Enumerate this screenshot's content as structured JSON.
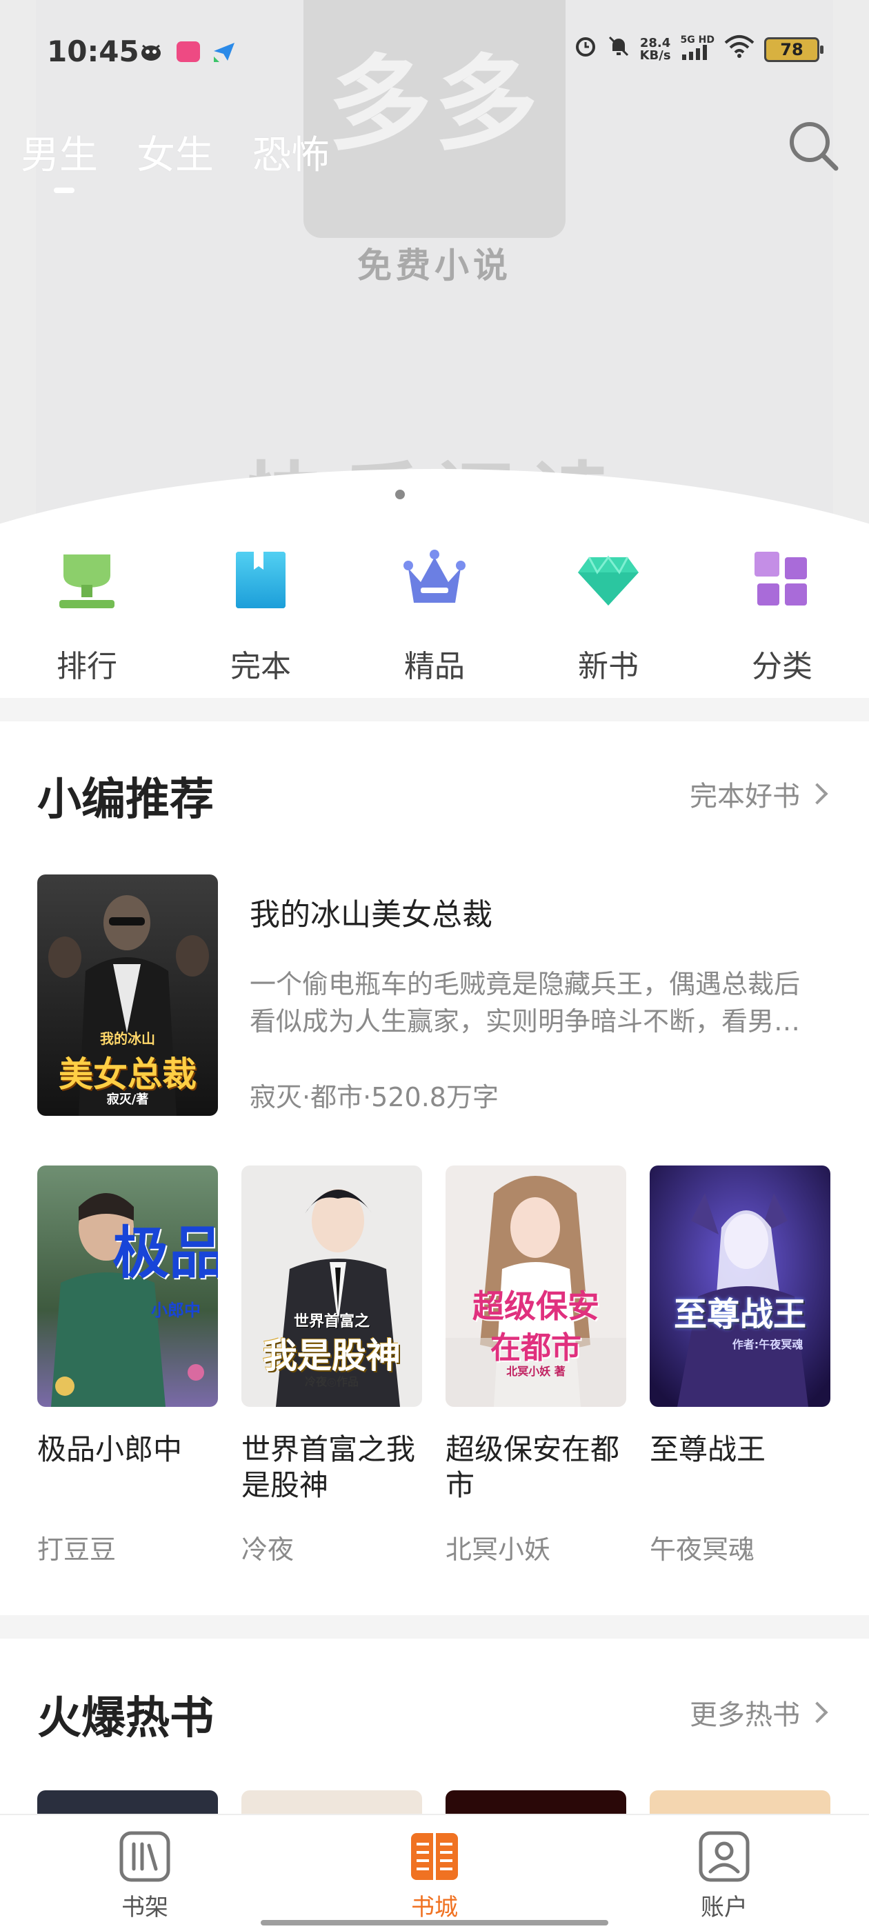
{
  "status_bar": {
    "time": "10:45",
    "net_speed_value": "28.4",
    "net_speed_unit": "KB/s",
    "net_type": "5G HD",
    "battery": "78"
  },
  "banner": {
    "logo_text": "多多",
    "logo_subtitle": "免费小说",
    "big_text": "快乐阅读",
    "active_slide": 1
  },
  "channel_tabs": [
    {
      "label": "男生",
      "active": true
    },
    {
      "label": "女生",
      "active": false
    },
    {
      "label": "恐怖",
      "active": false
    }
  ],
  "categories": [
    {
      "label": "排行",
      "icon": "trophy-icon"
    },
    {
      "label": "完本",
      "icon": "book-icon"
    },
    {
      "label": "精品",
      "icon": "crown-icon"
    },
    {
      "label": "新书",
      "icon": "diamond-icon"
    },
    {
      "label": "分类",
      "icon": "grid-icon"
    }
  ],
  "editor_picks": {
    "title": "小编推荐",
    "more_label": "完本好书",
    "featured": {
      "title": "我的冰山美女总裁",
      "description": "一个偷电瓶车的毛贼竟是隐藏兵王，偶遇总裁后看似成为人生赢家，实则明争暗斗不断，看男主如何周旋其中…",
      "meta": "寂灭·都市·520.8万字",
      "cover_title": "美女总裁",
      "cover_top": "我的冰山",
      "cover_author": "寂灭/著"
    },
    "books": [
      {
        "title": "极品小郎中",
        "author": "打豆豆",
        "cover_text": "极品",
        "cover_sub": "小郎中"
      },
      {
        "title": "世界首富之我是股神",
        "author": "冷夜",
        "cover_text": "我是股神",
        "cover_sub": "世界首富之",
        "cover_author": "冷夜◎作品"
      },
      {
        "title": "超级保安在都市",
        "author": "北冥小妖",
        "cover_text": "超级保安",
        "cover_sub": "在都市",
        "cover_author": "北冥小妖 著"
      },
      {
        "title": "至尊战王",
        "author": "午夜冥魂",
        "cover_text": "至尊战王",
        "cover_author": "作者:午夜冥魂"
      }
    ]
  },
  "hot_books": {
    "title": "火爆热书",
    "more_label": "更多热书"
  },
  "bottom_nav": [
    {
      "label": "书架",
      "icon": "bookshelf-icon",
      "active": false
    },
    {
      "label": "书城",
      "icon": "bookstore-icon",
      "active": true
    },
    {
      "label": "账户",
      "icon": "account-icon",
      "active": false
    }
  ],
  "colors": {
    "accent": "#f07222",
    "text_primary": "#222222",
    "text_secondary": "#8a8a8a",
    "separator": "#f4f4f4"
  }
}
